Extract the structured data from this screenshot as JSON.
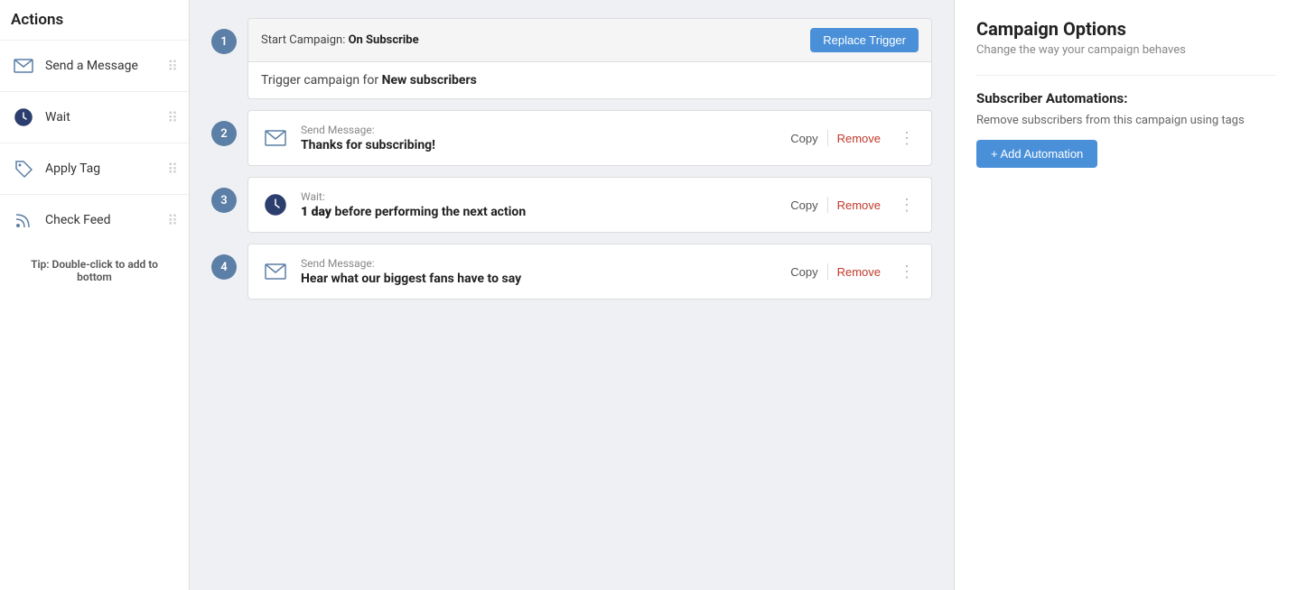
{
  "sidebar": {
    "title": "Actions",
    "items": [
      {
        "id": "send-message",
        "label": "Send a Message",
        "icon": "envelope-icon"
      },
      {
        "id": "wait",
        "label": "Wait",
        "icon": "clock-icon"
      },
      {
        "id": "apply-tag",
        "label": "Apply Tag",
        "icon": "tag-icon"
      },
      {
        "id": "check-feed",
        "label": "Check Feed",
        "icon": "feed-icon"
      }
    ],
    "tip_prefix": "Tip:",
    "tip_text": " Double-click to add to bottom"
  },
  "main": {
    "steps": [
      {
        "number": "1",
        "type": "trigger",
        "header_prefix": "Start Campaign: ",
        "header_highlight": "On Subscribe",
        "replace_btn": "Replace Trigger",
        "body_prefix": "Trigger campaign for ",
        "body_highlight": "New subscribers"
      },
      {
        "number": "2",
        "type": "send-message",
        "label": "Send Message:",
        "title": "Thanks for subscribing!",
        "copy_btn": "Copy",
        "remove_btn": "Remove"
      },
      {
        "number": "3",
        "type": "wait",
        "label": "Wait:",
        "title_prefix": "",
        "title_highlight": "1 day",
        "title_suffix": " before performing the next action",
        "copy_btn": "Copy",
        "remove_btn": "Remove"
      },
      {
        "number": "4",
        "type": "send-message",
        "label": "Send Message:",
        "title": "Hear what our biggest fans have to say",
        "copy_btn": "Copy",
        "remove_btn": "Remove"
      }
    ]
  },
  "rightPanel": {
    "title": "Campaign Options",
    "subtitle": "Change the way your campaign behaves",
    "section1_title": "Subscriber Automations:",
    "section1_desc": "Remove subscribers from this campaign using tags",
    "add_automation_btn": "+ Add Automation"
  }
}
